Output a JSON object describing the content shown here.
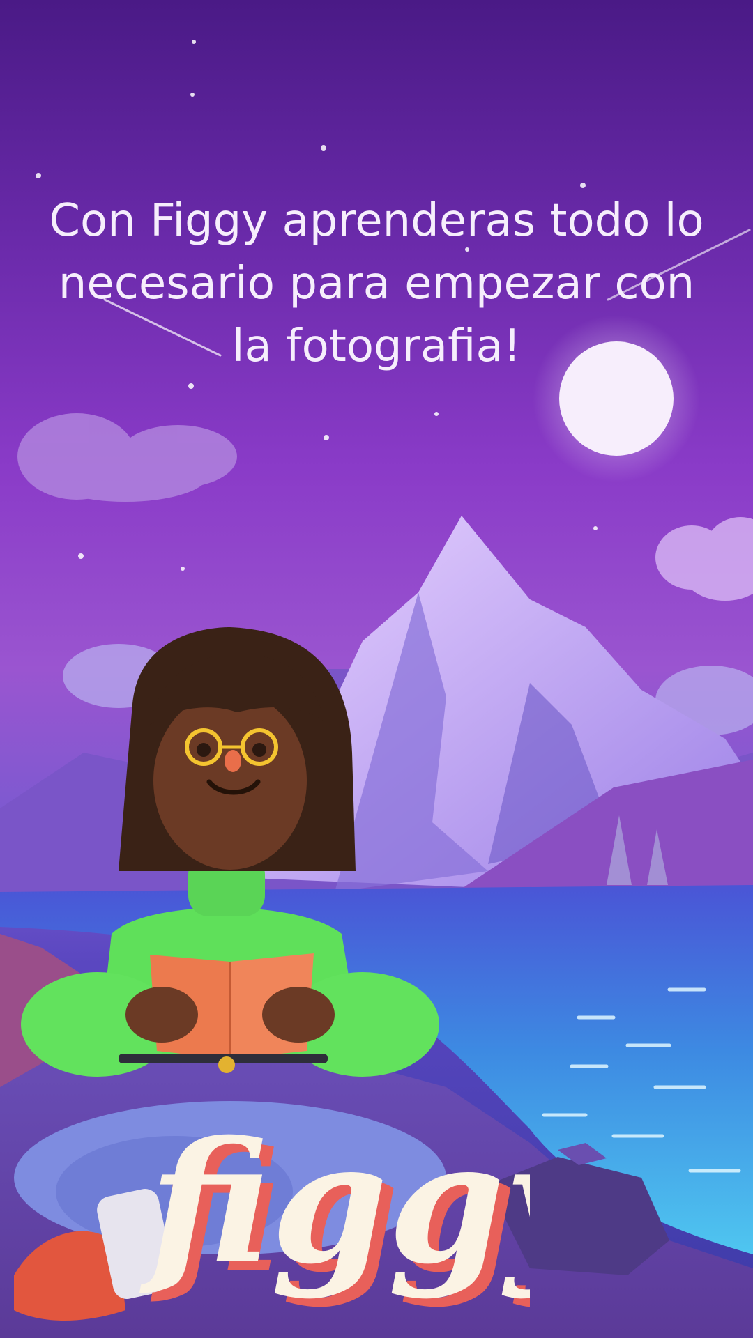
{
  "onboarding": {
    "headline": "Con Figgy aprenderas todo lo necesario para empezar con la fotografia!",
    "illustration_icon": "girl-reading-book-by-mountain-lake-illustration",
    "logo_text": "figgy"
  },
  "colors": {
    "sky_top": "#4a1a86",
    "sky_mid": "#9a55d0",
    "moon": "#f7eefc",
    "lake": "#3fb7ea",
    "headline_text": "#f6eefc",
    "logo_fill": "#fbf3e4",
    "logo_shadow": "#e8605a"
  }
}
